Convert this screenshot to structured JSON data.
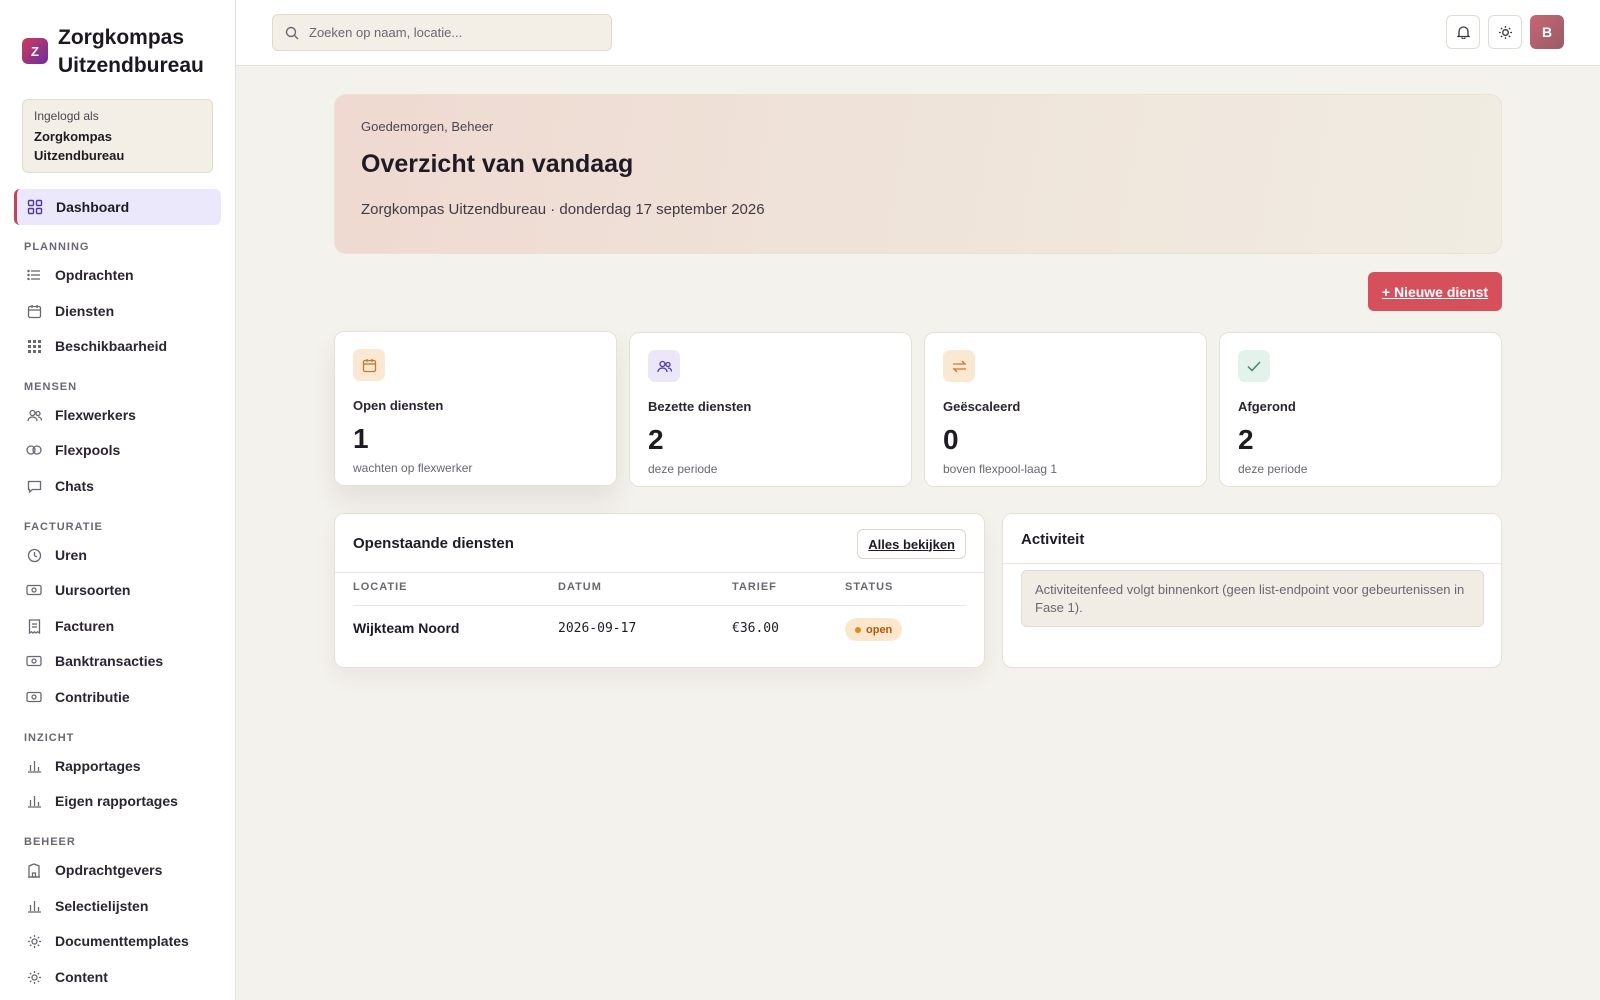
{
  "brand": {
    "logo_letter": "Z",
    "name": "Zorgkompas Uitzendbureau"
  },
  "user_box": {
    "label": "Ingelogd als",
    "name": "Zorgkompas Uitzendbureau"
  },
  "sidebar": {
    "dashboard": {
      "label": "Dashboard",
      "icon": "grid-icon"
    },
    "sections": [
      {
        "title": "PLANNING",
        "items": [
          {
            "label": "Opdrachten",
            "icon": "list-icon"
          },
          {
            "label": "Diensten",
            "icon": "calendar-icon"
          },
          {
            "label": "Beschikbaarheid",
            "icon": "dots-grid-icon"
          }
        ]
      },
      {
        "title": "MENSEN",
        "items": [
          {
            "label": "Flexwerkers",
            "icon": "users-icon"
          },
          {
            "label": "Flexpools",
            "icon": "circles-icon"
          },
          {
            "label": "Chats",
            "icon": "chat-icon"
          }
        ]
      },
      {
        "title": "FACTURATIE",
        "items": [
          {
            "label": "Uren",
            "icon": "clock-icon"
          },
          {
            "label": "Uursoorten",
            "icon": "banknote-icon"
          },
          {
            "label": "Facturen",
            "icon": "receipt-icon"
          },
          {
            "label": "Banktransacties",
            "icon": "banknote-icon"
          },
          {
            "label": "Contributie",
            "icon": "banknote-icon"
          }
        ]
      },
      {
        "title": "INZICHT",
        "items": [
          {
            "label": "Rapportages",
            "icon": "bar-chart-icon"
          },
          {
            "label": "Eigen rapportages",
            "icon": "bar-chart-icon"
          }
        ]
      },
      {
        "title": "BEHEER",
        "items": [
          {
            "label": "Opdrachtgevers",
            "icon": "building-icon"
          },
          {
            "label": "Selectielijsten",
            "icon": "bar-chart-icon"
          },
          {
            "label": "Documenttemplates",
            "icon": "sun-icon"
          },
          {
            "label": "Content",
            "icon": "sun-icon"
          }
        ]
      }
    ]
  },
  "topbar": {
    "search_placeholder": "Zoeken op naam, locatie...",
    "avatar_initial": "B"
  },
  "hero": {
    "greeting": "Goedemorgen, Beheer",
    "title": "Overzicht van vandaag",
    "subtitle": "Zorgkompas Uitzendbureau · donderdag 17 september 2026"
  },
  "actions": {
    "new_shift": "+ Nieuwe dienst"
  },
  "stats": [
    {
      "label": "Open diensten",
      "value": "1",
      "note": "wachten op flexwerker",
      "icon": "calendar-icon",
      "color": "#c9772a",
      "bg": "#fbe8d2"
    },
    {
      "label": "Bezette diensten",
      "value": "2",
      "note": "deze periode",
      "icon": "users-icon",
      "color": "#4f3aa0",
      "bg": "#ebe7f8"
    },
    {
      "label": "Geëscaleerd",
      "value": "0",
      "note": "boven flexpool-laag 1",
      "icon": "swap-icon",
      "color": "#c9772a",
      "bg": "#fbe8d2"
    },
    {
      "label": "Afgerond",
      "value": "2",
      "note": "deze periode",
      "icon": "check-icon",
      "color": "#3f8a6a",
      "bg": "#e3f2ea"
    }
  ],
  "open_shifts": {
    "title": "Openstaande diensten",
    "view_all": "Alles bekijken",
    "columns": [
      "LOCATIE",
      "DATUM",
      "TARIEF",
      "STATUS"
    ],
    "rows": [
      {
        "location": "Wijkteam Noord",
        "date": "2026-09-17",
        "rate": "€36.00",
        "status": "open"
      }
    ]
  },
  "activity": {
    "title": "Activiteit",
    "note": "Activiteitenfeed volgt binnenkort (geen list-endpoint voor gebeurtenissen in Fase 1)."
  },
  "colors": {
    "accent": "#d6505c",
    "active_nav_bg": "#ece8fb",
    "page_bg": "#f4f2ed"
  }
}
